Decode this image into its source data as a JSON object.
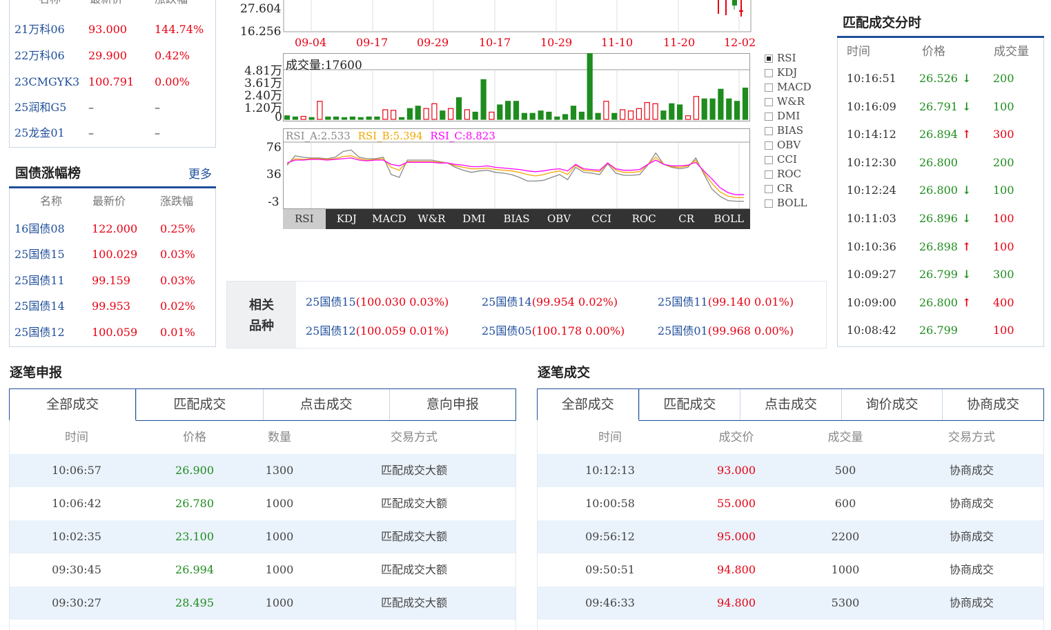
{
  "left_top": {
    "headers": [
      "名称",
      "最新价",
      "涨跌幅"
    ],
    "rows": [
      {
        "name": "21万科06",
        "price": "93.000",
        "change": "144.74%"
      },
      {
        "name": "22万科06",
        "price": "29.900",
        "change": "0.42%"
      },
      {
        "name": "23CMGYK3",
        "price": "100.791",
        "change": "0.00%"
      },
      {
        "name": "25润和G5",
        "price": "–",
        "change": "–"
      },
      {
        "name": "25龙金01",
        "price": "–",
        "change": "–"
      }
    ]
  },
  "treasury": {
    "title": "国债涨幅榜",
    "more": "更多",
    "headers": [
      "名称",
      "最新价",
      "涨跌幅"
    ],
    "rows": [
      {
        "name": "16国债08",
        "price": "122.000",
        "change": "0.25%"
      },
      {
        "name": "25国债15",
        "price": "100.029",
        "change": "0.03%"
      },
      {
        "name": "25国债11",
        "price": "99.159",
        "change": "0.03%"
      },
      {
        "name": "25国债14",
        "price": "99.953",
        "change": "0.02%"
      },
      {
        "name": "25国债12",
        "price": "100.059",
        "change": "0.01%"
      }
    ]
  },
  "price_chart": {
    "y_ticks": [
      "27.604",
      "16.256"
    ],
    "x_dates": [
      "09-04",
      "09-17",
      "09-29",
      "10-17",
      "10-29",
      "11-10",
      "11-20",
      "12-02"
    ]
  },
  "volume_chart": {
    "label": "成交量:17600",
    "y_ticks": [
      "4.81万",
      "3.61万",
      "2.40万",
      "1.20万",
      "0"
    ],
    "values": [
      0.3,
      0.2,
      0.25,
      0.15,
      1.5,
      0.2,
      0.2,
      0.15,
      0.2,
      0.15,
      0.2,
      0.2,
      0.8,
      0.75,
      0.15,
      0.9,
      1.1,
      0.9,
      1.3,
      0.7,
      0.9,
      1.8,
      0.8,
      0.6,
      3.3,
      0.6,
      1.2,
      1.5,
      1.5,
      0.5,
      0.5,
      0.7,
      0.6,
      0.2,
      0.4,
      1.1,
      0.6,
      6.6,
      0.5,
      1.5,
      0.5,
      0.8,
      0.7,
      0.9,
      1.4,
      1.3,
      0.7,
      1.3,
      1.2,
      0.3,
      1.9,
      1.7,
      1.7,
      2.5,
      1.7,
      1.5,
      2.6
    ],
    "up": [
      false,
      false,
      true,
      false,
      true,
      false,
      false,
      false,
      false,
      false,
      false,
      false,
      true,
      true,
      false,
      false,
      false,
      true,
      true,
      false,
      true,
      false,
      true,
      false,
      false,
      true,
      false,
      false,
      false,
      false,
      false,
      false,
      false,
      false,
      false,
      false,
      false,
      false,
      false,
      true,
      false,
      true,
      true,
      true,
      true,
      true,
      false,
      false,
      false,
      true,
      true,
      false,
      false,
      false,
      false,
      false,
      false
    ],
    "y_max": 4.81
  },
  "rsi_chart": {
    "legend": {
      "a": "RSI_A:2.533",
      "b": "RSI_B:5.394",
      "c": "RSI_C:8.823"
    },
    "colors": {
      "a": "#888888",
      "b": "#f0a800",
      "c": "#ff00ff"
    },
    "y_ticks": [
      "76",
      "36",
      "-3"
    ],
    "y_range": [
      -3,
      85
    ],
    "series_a": [
      55,
      68,
      66,
      65,
      65,
      64,
      66,
      74,
      76,
      66,
      64,
      64,
      66,
      42,
      38,
      62,
      62,
      62,
      62,
      60,
      58,
      52,
      48,
      45,
      47,
      48,
      45,
      44,
      42,
      38,
      33,
      33,
      34,
      38,
      42,
      35,
      52,
      45,
      44,
      42,
      57,
      44,
      41,
      41,
      42,
      55,
      72,
      56,
      52,
      50,
      52,
      65,
      43,
      22,
      12,
      6,
      5,
      5
    ],
    "series_b": [
      57,
      64,
      63,
      64,
      64,
      63,
      64,
      67,
      68,
      64,
      62,
      63,
      64,
      52,
      48,
      60,
      60,
      60,
      60,
      59,
      58,
      54,
      52,
      50,
      50,
      51,
      49,
      48,
      47,
      45,
      42,
      40,
      42,
      45,
      47,
      42,
      55,
      48,
      47,
      46,
      58,
      48,
      45,
      45,
      46,
      56,
      66,
      56,
      53,
      52,
      54,
      62,
      45,
      30,
      18,
      12,
      10,
      10
    ],
    "series_c": [
      58,
      62,
      62,
      63,
      63,
      62,
      63,
      64,
      65,
      62,
      61,
      62,
      62,
      56,
      54,
      59,
      59,
      59,
      59,
      58,
      58,
      56,
      55,
      53,
      53,
      54,
      52,
      51,
      50,
      49,
      47,
      46,
      47,
      49,
      50,
      47,
      56,
      50,
      49,
      48,
      58,
      50,
      48,
      48,
      49,
      56,
      62,
      56,
      54,
      54,
      55,
      59,
      47,
      36,
      24,
      17,
      14,
      14
    ]
  },
  "indicators": {
    "list": [
      "RSI",
      "KDJ",
      "MACD",
      "W&R",
      "DMI",
      "BIAS",
      "OBV",
      "CCI",
      "ROC",
      "CR",
      "BOLL"
    ],
    "selected": "RSI"
  },
  "related": {
    "label_1": "相关",
    "label_2": "品种",
    "items": [
      {
        "name": "25国债15",
        "detail": "(100.030  0.03%)"
      },
      {
        "name": "25国债14",
        "detail": "(99.954  0.02%)"
      },
      {
        "name": "25国债11",
        "detail": "(99.140  0.01%)"
      },
      {
        "name": "25国债12",
        "detail": "(100.059  0.01%)"
      },
      {
        "name": "25国债05",
        "detail": "(100.178  0.00%)"
      },
      {
        "name": "25国债01",
        "detail": "(99.968  0.00%)"
      }
    ]
  },
  "match_ticks": {
    "title": "匹配成交分时",
    "headers": [
      "时间",
      "价格",
      "成交量"
    ],
    "rows": [
      {
        "time": "10:16:51",
        "price": "26.526",
        "arrow": "↓",
        "dir": "down",
        "vol": "200",
        "vcolor": "green"
      },
      {
        "time": "10:16:09",
        "price": "26.791",
        "arrow": "↓",
        "dir": "down",
        "vol": "100",
        "vcolor": "green"
      },
      {
        "time": "10:14:12",
        "price": "26.894",
        "arrow": "↑",
        "dir": "up",
        "vol": "300",
        "vcolor": "red"
      },
      {
        "time": "10:12:30",
        "price": "26.800",
        "arrow": "",
        "dir": "none",
        "vol": "200",
        "vcolor": "green"
      },
      {
        "time": "10:12:24",
        "price": "26.800",
        "arrow": "↓",
        "dir": "down",
        "vol": "100",
        "vcolor": "green"
      },
      {
        "time": "10:11:03",
        "price": "26.896",
        "arrow": "↓",
        "dir": "down",
        "vol": "100",
        "vcolor": "red"
      },
      {
        "time": "10:10:36",
        "price": "26.898",
        "arrow": "↑",
        "dir": "up",
        "vol": "100",
        "vcolor": "red"
      },
      {
        "time": "10:09:27",
        "price": "26.799",
        "arrow": "↓",
        "dir": "down",
        "vol": "300",
        "vcolor": "green"
      },
      {
        "time": "10:09:00",
        "price": "26.800",
        "arrow": "↑",
        "dir": "up",
        "vol": "400",
        "vcolor": "red"
      },
      {
        "time": "10:08:42",
        "price": "26.799",
        "arrow": "",
        "dir": "none",
        "vol": "100",
        "vcolor": "red"
      }
    ]
  },
  "orders": {
    "title": "逐笔申报",
    "tabs": [
      "全部成交",
      "匹配成交",
      "点击成交",
      "意向申报"
    ],
    "headers": [
      "时间",
      "价格",
      "数量",
      "交易方式"
    ],
    "rows": [
      {
        "time": "10:06:57",
        "price": "26.900",
        "qty": "1300",
        "mode": "匹配成交大额"
      },
      {
        "time": "10:06:42",
        "price": "26.780",
        "qty": "1000",
        "mode": "匹配成交大额"
      },
      {
        "time": "10:02:35",
        "price": "23.100",
        "qty": "1000",
        "mode": "匹配成交大额"
      },
      {
        "time": "09:30:45",
        "price": "26.994",
        "qty": "1000",
        "mode": "匹配成交大额"
      },
      {
        "time": "09:30:27",
        "price": "28.495",
        "qty": "1000",
        "mode": "匹配成交大额"
      }
    ]
  },
  "trades": {
    "title": "逐笔成交",
    "tabs": [
      "全部成交",
      "匹配成交",
      "点击成交",
      "询价成交",
      "协商成交"
    ],
    "headers": [
      "时间",
      "成交价",
      "成交量",
      "交易方式"
    ],
    "rows": [
      {
        "time": "10:12:13",
        "price": "93.000",
        "vol": "500",
        "mode": "协商成交"
      },
      {
        "time": "10:00:58",
        "price": "55.000",
        "vol": "600",
        "mode": "协商成交"
      },
      {
        "time": "09:56:12",
        "price": "95.000",
        "vol": "2200",
        "mode": "协商成交"
      },
      {
        "time": "09:50:51",
        "price": "94.800",
        "vol": "1000",
        "mode": "协商成交"
      },
      {
        "time": "09:46:33",
        "price": "94.800",
        "vol": "5300",
        "mode": "协商成交"
      }
    ]
  }
}
